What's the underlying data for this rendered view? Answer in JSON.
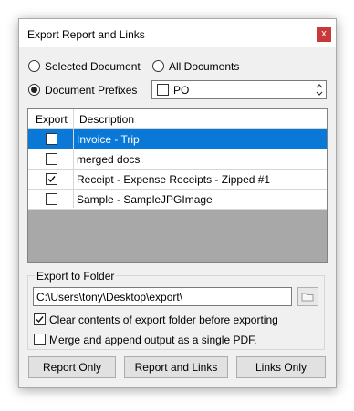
{
  "window": {
    "title": "Export Report and Links",
    "close_glyph": "x"
  },
  "options": {
    "selected_document": "Selected Document",
    "all_documents": "All Documents",
    "document_prefixes": "Document Prefixes",
    "selected": "document_prefixes",
    "prefix_value": "PO"
  },
  "table": {
    "headers": {
      "export": "Export",
      "description": "Description"
    },
    "rows": [
      {
        "checked": false,
        "description": "Invoice - Trip",
        "selected": true
      },
      {
        "checked": false,
        "description": "merged docs",
        "selected": false
      },
      {
        "checked": true,
        "description": "Receipt - Expense Receipts - Zipped #1",
        "selected": false
      },
      {
        "checked": false,
        "description": "Sample - SampleJPGImage",
        "selected": false
      }
    ]
  },
  "export_folder": {
    "group_label": "Export to Folder",
    "path": "C:\\Users\\tony\\Desktop\\export\\",
    "clear_label": "Clear contents of export folder before exporting",
    "clear_checked": true,
    "merge_label": "Merge and append output as a single PDF.",
    "merge_checked": false
  },
  "buttons": {
    "report_only": "Report Only",
    "report_and_links": "Report and Links",
    "links_only": "Links Only"
  },
  "colors": {
    "selection": "#0a78d7",
    "close": "#c83a3a",
    "grid_empty": "#a8a8a8"
  }
}
